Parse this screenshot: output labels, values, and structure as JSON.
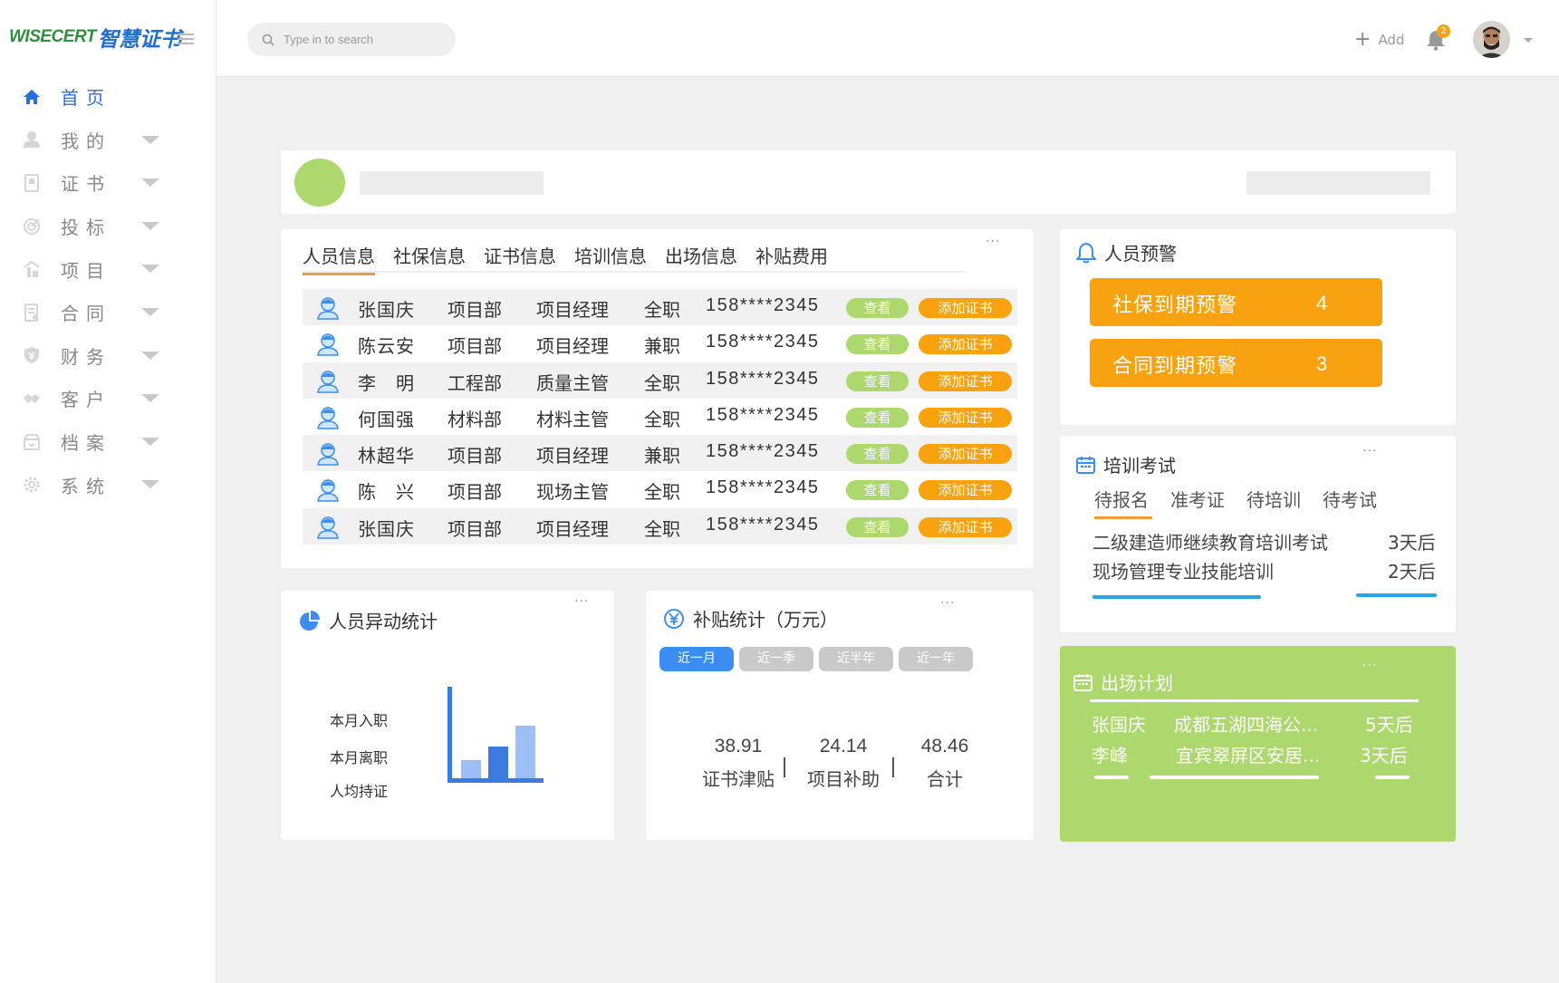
{
  "logo": {
    "en": "WISECERT",
    "cn": "智慧证书"
  },
  "sidebar": {
    "items": [
      {
        "label": "首页",
        "icon": "home-icon",
        "active": true,
        "has_caret": false
      },
      {
        "label": "我的",
        "icon": "user-icon",
        "active": false,
        "has_caret": true
      },
      {
        "label": "证书",
        "icon": "certificate-icon",
        "active": false,
        "has_caret": true
      },
      {
        "label": "投标",
        "icon": "target-icon",
        "active": false,
        "has_caret": true
      },
      {
        "label": "项目",
        "icon": "project-icon",
        "active": false,
        "has_caret": true
      },
      {
        "label": "合同",
        "icon": "contract-icon",
        "active": false,
        "has_caret": true
      },
      {
        "label": "财务",
        "icon": "finance-icon",
        "active": false,
        "has_caret": true
      },
      {
        "label": "客户",
        "icon": "handshake-icon",
        "active": false,
        "has_caret": true
      },
      {
        "label": "档案",
        "icon": "archive-icon",
        "active": false,
        "has_caret": true
      },
      {
        "label": "系统",
        "icon": "gear-icon",
        "active": false,
        "has_caret": true
      }
    ]
  },
  "header": {
    "search_placeholder": "Type in to search",
    "add_label": "Add",
    "notification_count": "2"
  },
  "personnel": {
    "tabs": [
      "人员信息",
      "社保信息",
      "证书信息",
      "培训信息",
      "出场信息",
      "补贴费用"
    ],
    "rows": [
      {
        "name": "张国庆",
        "dept": "项目部",
        "position": "项目经理",
        "type": "全职",
        "phone": "158****2345"
      },
      {
        "name": "陈云安",
        "dept": "项目部",
        "position": "项目经理",
        "type": "兼职",
        "phone": "158****2345"
      },
      {
        "name": "李　明",
        "dept": "工程部",
        "position": "质量主管",
        "type": "全职",
        "phone": "158****2345"
      },
      {
        "name": "何国强",
        "dept": "材料部",
        "position": "材料主管",
        "type": "全职",
        "phone": "158****2345"
      },
      {
        "name": "林超华",
        "dept": "项目部",
        "position": "项目经理",
        "type": "兼职",
        "phone": "158****2345"
      },
      {
        "name": "陈　兴",
        "dept": "项目部",
        "position": "现场主管",
        "type": "全职",
        "phone": "158****2345"
      },
      {
        "name": "张国庆",
        "dept": "项目部",
        "position": "项目经理",
        "type": "全职",
        "phone": "158****2345"
      }
    ],
    "view_label": "查看",
    "add_cert_label": "添加证书"
  },
  "warning": {
    "title": "人员预警",
    "items": [
      {
        "label": "社保到期预警",
        "count": "4"
      },
      {
        "label": "合同到期预警",
        "count": "3"
      }
    ]
  },
  "training": {
    "title": "培训考试",
    "tabs": [
      "待报名",
      "准考证",
      "待培训",
      "待考试"
    ],
    "items": [
      {
        "name": "二级建造师继续教育培训考试",
        "when": "3天后"
      },
      {
        "name": "现场管理专业技能培训",
        "when": "2天后"
      }
    ]
  },
  "plan": {
    "title": "出场计划",
    "items": [
      {
        "person": "张国庆",
        "place": "成都五湖四海公...",
        "when": "5天后"
      },
      {
        "person": "李峰",
        "place": "宜宾翠屏区安居...",
        "when": "3天后"
      }
    ]
  },
  "change_stats": {
    "title": "人员异动统计",
    "labels": [
      "本月入职",
      "本月离职",
      "人均持证"
    ],
    "bar_levels": [
      0.2,
      0.35,
      0.57
    ]
  },
  "subsidy": {
    "title": "补贴统计（万元）",
    "periods": [
      "近一月",
      "近一季",
      "近半年",
      "近一年"
    ],
    "active_period": "近一月",
    "items": [
      {
        "value": "38.91",
        "label": "证书津贴"
      },
      {
        "value": "24.14",
        "label": "项目补助"
      },
      {
        "value": "48.46",
        "label": "合计"
      }
    ]
  },
  "colors": {
    "accent_blue": "#2b6fe0",
    "orange": "#f7a20e",
    "green": "#acd86e",
    "tab_underline": "#f29a3c"
  }
}
